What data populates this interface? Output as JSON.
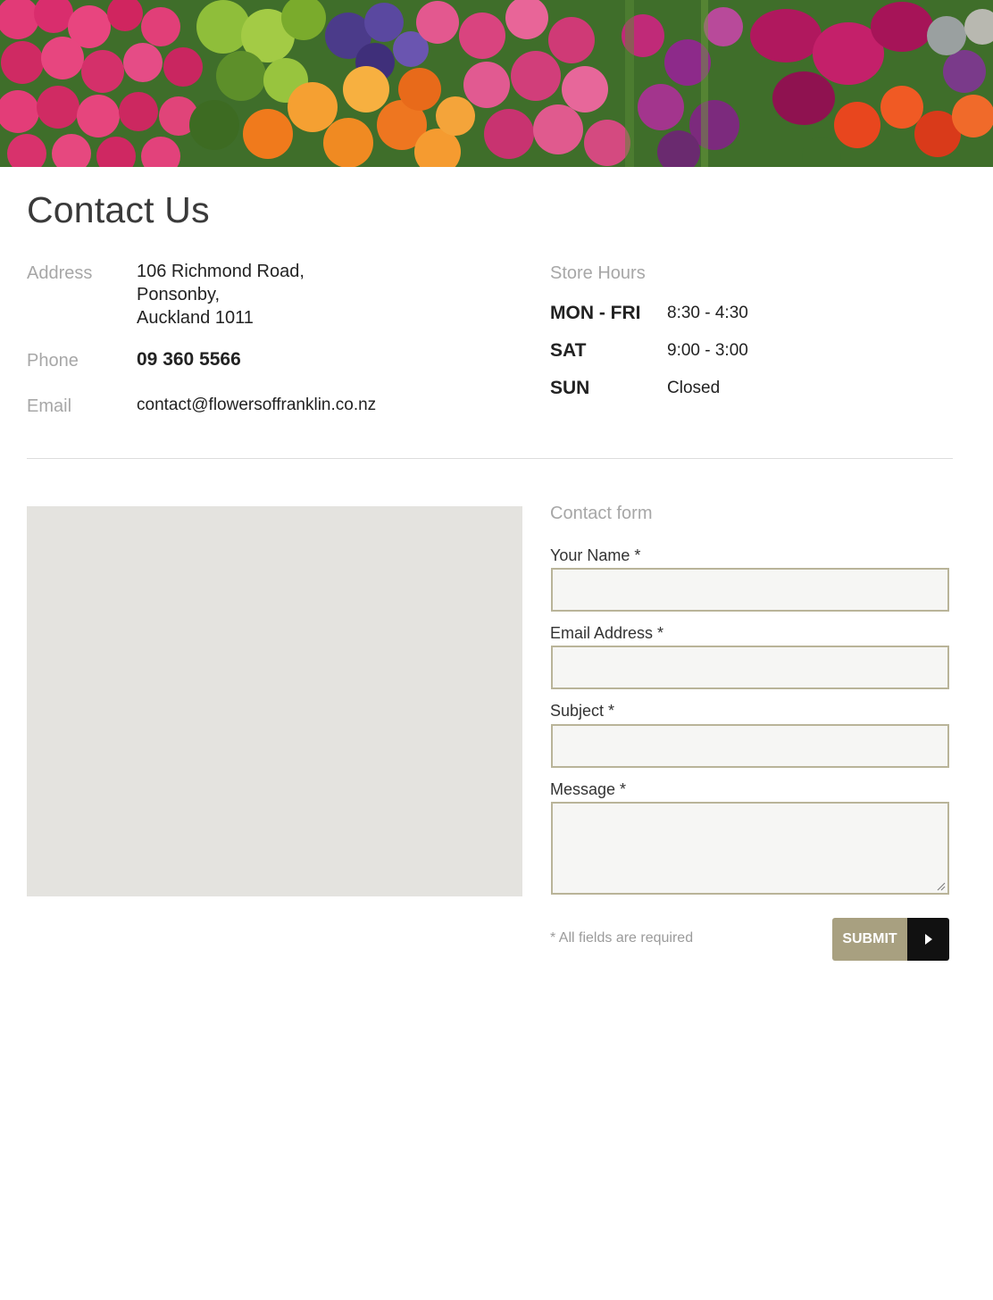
{
  "page": {
    "title": "Contact Us"
  },
  "hero": {
    "image": "flowers-banner"
  },
  "contact": {
    "address_label": "Address",
    "address_lines": [
      "106 Richmond Road,",
      "Ponsonby,",
      "Auckland 1011"
    ],
    "phone_label": "Phone",
    "phone": "09 360 5566",
    "email_label": "Email",
    "email": "contact@flowersoffranklin.co.nz"
  },
  "hours": {
    "title": "Store Hours",
    "rows": [
      {
        "day": "MON - FRI",
        "time": "8:30 - 4:30"
      },
      {
        "day": "SAT",
        "time": "9:00 - 3:00"
      },
      {
        "day": "SUN",
        "time": "Closed"
      }
    ]
  },
  "form": {
    "title": "Contact form",
    "fields": [
      {
        "label": "Your Name *",
        "value": ""
      },
      {
        "label": "Email Address *",
        "value": ""
      },
      {
        "label": "Subject *",
        "value": ""
      },
      {
        "label": "Message *",
        "value": ""
      }
    ],
    "required_note": "* All fields are required",
    "submit_label": "SUBMIT",
    "submit_icon": "play-arrow-icon"
  },
  "colors": {
    "accent": "#a8a080",
    "field_border": "#b9b499",
    "map_placeholder": "#e4e3df"
  }
}
